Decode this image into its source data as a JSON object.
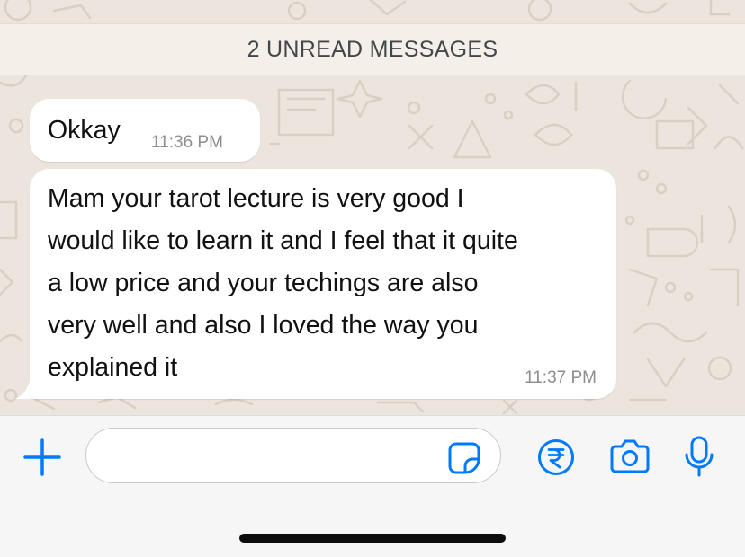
{
  "banner": {
    "label": "2 UNREAD MESSAGES"
  },
  "messages": [
    {
      "lines": [
        "Okkay"
      ],
      "time": "11:36 PM"
    },
    {
      "lines": [
        "Mam your tarot lecture is very good I",
        "would like to learn it and I feel that it quite",
        "a low price and your techings are also",
        "very well and also I loved the way you",
        "explained it"
      ],
      "time": "11:37 PM"
    }
  ],
  "composer": {
    "icons": [
      "plus-icon",
      "sticker-icon",
      "rupee-icon",
      "camera-icon",
      "microphone-icon"
    ],
    "input_value": ""
  },
  "colors": {
    "accent": "#007aff",
    "chat_background": "#ece5dd",
    "bubble": "#ffffff",
    "banner": "#f4efe8"
  }
}
